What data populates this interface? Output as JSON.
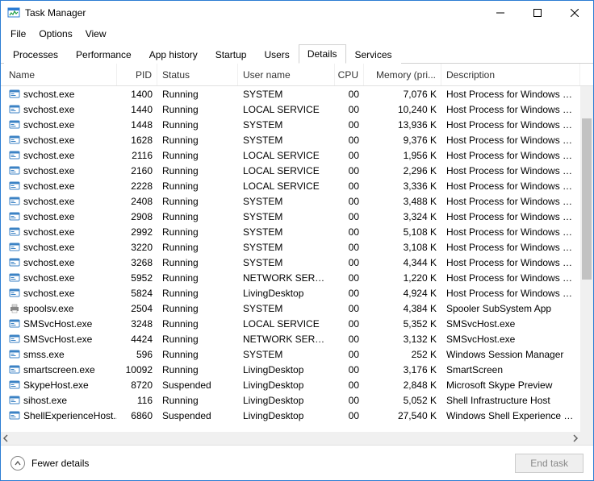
{
  "window": {
    "title": "Task Manager"
  },
  "menu": {
    "file": "File",
    "options": "Options",
    "view": "View"
  },
  "tabs": {
    "processes": "Processes",
    "performance": "Performance",
    "app_history": "App history",
    "startup": "Startup",
    "users": "Users",
    "details": "Details",
    "services": "Services"
  },
  "columns": {
    "name": "Name",
    "pid": "PID",
    "status": "Status",
    "user": "User name",
    "cpu": "CPU",
    "mem": "Memory (pri...",
    "desc": "Description"
  },
  "footer": {
    "fewer": "Fewer details",
    "end_task": "End task"
  },
  "rows": [
    {
      "icon": "exe",
      "name": "svchost.exe",
      "pid": "1400",
      "status": "Running",
      "user": "SYSTEM",
      "cpu": "00",
      "mem": "7,076 K",
      "desc": "Host Process for Windows Serv"
    },
    {
      "icon": "exe",
      "name": "svchost.exe",
      "pid": "1440",
      "status": "Running",
      "user": "LOCAL SERVICE",
      "cpu": "00",
      "mem": "10,240 K",
      "desc": "Host Process for Windows Serv"
    },
    {
      "icon": "exe",
      "name": "svchost.exe",
      "pid": "1448",
      "status": "Running",
      "user": "SYSTEM",
      "cpu": "00",
      "mem": "13,936 K",
      "desc": "Host Process for Windows Serv"
    },
    {
      "icon": "exe",
      "name": "svchost.exe",
      "pid": "1628",
      "status": "Running",
      "user": "SYSTEM",
      "cpu": "00",
      "mem": "9,376 K",
      "desc": "Host Process for Windows Serv"
    },
    {
      "icon": "exe",
      "name": "svchost.exe",
      "pid": "2116",
      "status": "Running",
      "user": "LOCAL SERVICE",
      "cpu": "00",
      "mem": "1,956 K",
      "desc": "Host Process for Windows Serv"
    },
    {
      "icon": "exe",
      "name": "svchost.exe",
      "pid": "2160",
      "status": "Running",
      "user": "LOCAL SERVICE",
      "cpu": "00",
      "mem": "2,296 K",
      "desc": "Host Process for Windows Serv"
    },
    {
      "icon": "exe",
      "name": "svchost.exe",
      "pid": "2228",
      "status": "Running",
      "user": "LOCAL SERVICE",
      "cpu": "00",
      "mem": "3,336 K",
      "desc": "Host Process for Windows Serv"
    },
    {
      "icon": "exe",
      "name": "svchost.exe",
      "pid": "2408",
      "status": "Running",
      "user": "SYSTEM",
      "cpu": "00",
      "mem": "3,488 K",
      "desc": "Host Process for Windows Serv"
    },
    {
      "icon": "exe",
      "name": "svchost.exe",
      "pid": "2908",
      "status": "Running",
      "user": "SYSTEM",
      "cpu": "00",
      "mem": "3,324 K",
      "desc": "Host Process for Windows Serv"
    },
    {
      "icon": "exe",
      "name": "svchost.exe",
      "pid": "2992",
      "status": "Running",
      "user": "SYSTEM",
      "cpu": "00",
      "mem": "5,108 K",
      "desc": "Host Process for Windows Serv"
    },
    {
      "icon": "exe",
      "name": "svchost.exe",
      "pid": "3220",
      "status": "Running",
      "user": "SYSTEM",
      "cpu": "00",
      "mem": "3,108 K",
      "desc": "Host Process for Windows Serv"
    },
    {
      "icon": "exe",
      "name": "svchost.exe",
      "pid": "3268",
      "status": "Running",
      "user": "SYSTEM",
      "cpu": "00",
      "mem": "4,344 K",
      "desc": "Host Process for Windows Serv"
    },
    {
      "icon": "exe",
      "name": "svchost.exe",
      "pid": "5952",
      "status": "Running",
      "user": "NETWORK SERVICE",
      "cpu": "00",
      "mem": "1,220 K",
      "desc": "Host Process for Windows Serv"
    },
    {
      "icon": "exe",
      "name": "svchost.exe",
      "pid": "5824",
      "status": "Running",
      "user": "LivingDesktop",
      "cpu": "00",
      "mem": "4,924 K",
      "desc": "Host Process for Windows Serv"
    },
    {
      "icon": "printer",
      "name": "spoolsv.exe",
      "pid": "2504",
      "status": "Running",
      "user": "SYSTEM",
      "cpu": "00",
      "mem": "4,384 K",
      "desc": "Spooler SubSystem App"
    },
    {
      "icon": "exe",
      "name": "SMSvcHost.exe",
      "pid": "3248",
      "status": "Running",
      "user": "LOCAL SERVICE",
      "cpu": "00",
      "mem": "5,352 K",
      "desc": "SMSvcHost.exe"
    },
    {
      "icon": "exe",
      "name": "SMSvcHost.exe",
      "pid": "4424",
      "status": "Running",
      "user": "NETWORK SERVICE",
      "cpu": "00",
      "mem": "3,132 K",
      "desc": "SMSvcHost.exe"
    },
    {
      "icon": "exe",
      "name": "smss.exe",
      "pid": "596",
      "status": "Running",
      "user": "SYSTEM",
      "cpu": "00",
      "mem": "252 K",
      "desc": "Windows Session Manager"
    },
    {
      "icon": "exe",
      "name": "smartscreen.exe",
      "pid": "10092",
      "status": "Running",
      "user": "LivingDesktop",
      "cpu": "00",
      "mem": "3,176 K",
      "desc": "SmartScreen"
    },
    {
      "icon": "exe",
      "name": "SkypeHost.exe",
      "pid": "8720",
      "status": "Suspended",
      "user": "LivingDesktop",
      "cpu": "00",
      "mem": "2,848 K",
      "desc": "Microsoft Skype Preview"
    },
    {
      "icon": "exe",
      "name": "sihost.exe",
      "pid": "116",
      "status": "Running",
      "user": "LivingDesktop",
      "cpu": "00",
      "mem": "5,052 K",
      "desc": "Shell Infrastructure Host"
    },
    {
      "icon": "exe",
      "name": "ShellExperienceHost....",
      "pid": "6860",
      "status": "Suspended",
      "user": "LivingDesktop",
      "cpu": "00",
      "mem": "27,540 K",
      "desc": "Windows Shell Experience Hos"
    }
  ]
}
